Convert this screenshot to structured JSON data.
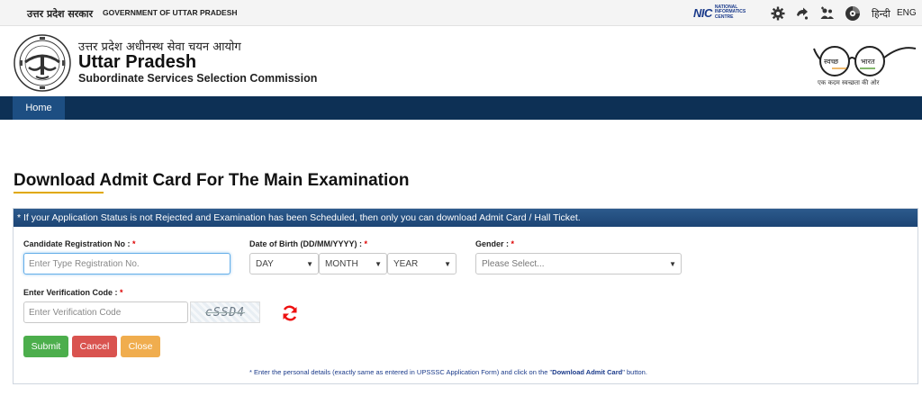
{
  "topbar": {
    "gov_hindi": "उत्तर प्रदेश सरकार",
    "gov_english": "GOVERNMENT OF UTTAR PRADESH",
    "nic_mark": "NIC",
    "nic_text": "NATIONAL INFORMATICS CENTRE",
    "lang_hindi": "हिन्दी",
    "lang_english": "ENG"
  },
  "header": {
    "org_hindi": "उत्तर प्रदेश अधीनस्थ सेवा चयन आयोग",
    "org_main": "Uttar Pradesh",
    "org_sub": "Subordinate Services Selection Commission",
    "swachh_left": "स्वच्छ",
    "swachh_right": "भारत",
    "swachh_tagline": "एक कदम स्वच्छता की ओर"
  },
  "nav": {
    "home": "Home"
  },
  "page": {
    "title": "Download Admit Card For The Main Examination",
    "notice": "* If your Application Status is not Rejected and Examination has been Scheduled, then only you can download Admit Card / Hall Ticket."
  },
  "form": {
    "reg_label": "Candidate Registration No :",
    "reg_placeholder": "Enter Type Registration No.",
    "dob_label": "Date of Birth (DD/MM/YYYY) :",
    "day": "DAY",
    "month": "MONTH",
    "year": "YEAR",
    "gender_label": "Gender :",
    "gender_placeholder": "Please Select...",
    "verif_label": "Enter Verification Code :",
    "verif_placeholder": "Enter Verification Code",
    "captcha_text": "cSSD4",
    "required_mark": "*",
    "submit": "Submit",
    "cancel": "Cancel",
    "close": "Close",
    "footnote_pre": "* Enter the personal details (exactly same as entered in UPSSSC Application Form) and click on the \"",
    "footnote_link": "Download Admit Card",
    "footnote_post": "\" button."
  },
  "colors": {
    "nav_bg": "#0d3055",
    "notice_bg": "#1c4474",
    "submit": "#4cae4c",
    "cancel": "#d9534f",
    "close": "#f0ad4e",
    "accent_underline": "#e0a800"
  }
}
